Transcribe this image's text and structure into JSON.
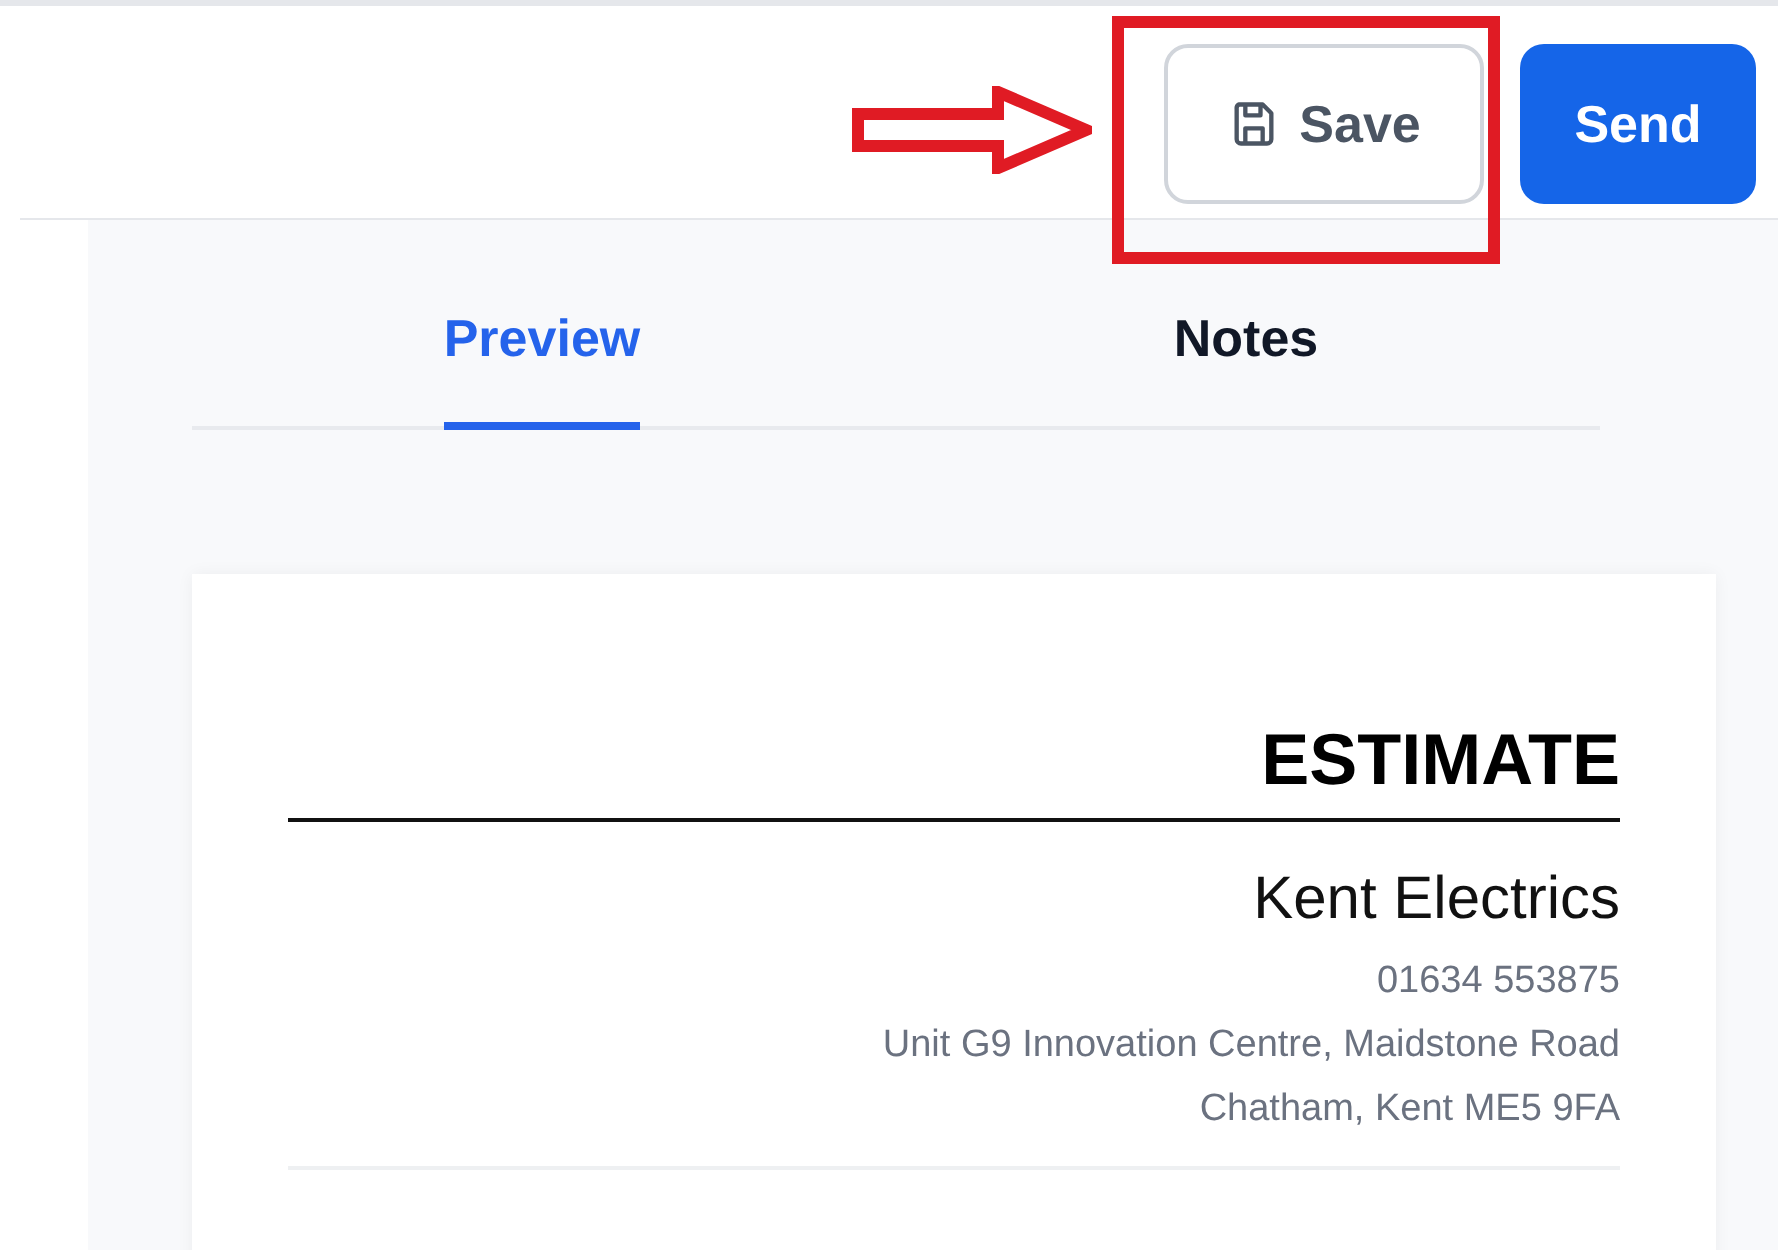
{
  "toolbar": {
    "buttons": [
      {
        "label": "Save",
        "kind": "save"
      },
      {
        "label": "Send",
        "kind": "primary"
      }
    ]
  },
  "tabs": [
    {
      "label": "Preview",
      "selected": true
    },
    {
      "label": "Notes",
      "selected": false
    }
  ],
  "document": {
    "title": "ESTIMATE",
    "company": "Kent Electrics",
    "phone": "01634 553875",
    "address_lines": [
      "Unit G9 Innovation Centre, Maidstone Road",
      "Chatham, Kent ME5 9FA"
    ]
  }
}
